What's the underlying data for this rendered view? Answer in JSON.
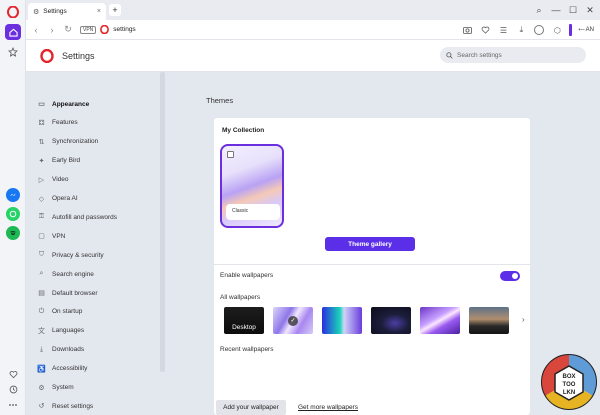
{
  "browser": {
    "tab": {
      "title": "Settings",
      "close": "×"
    },
    "new_tab": "+",
    "address": {
      "vpn": "VPN",
      "url": "settings"
    },
    "aria": "AN",
    "window_controls": {
      "search": "⌕",
      "minimize": "—",
      "maximize": "☐",
      "close": "✕"
    }
  },
  "settings": {
    "title": "Settings",
    "search_placeholder": "Search settings"
  },
  "nav": [
    {
      "label": "Appearance",
      "icon": "appearance-icon",
      "glyph": "▭",
      "active": true
    },
    {
      "label": "Features",
      "icon": "features-icon",
      "glyph": "⚃"
    },
    {
      "label": "Synchronization",
      "icon": "sync-icon",
      "glyph": "⇅"
    },
    {
      "label": "Early Bird",
      "icon": "bird-icon",
      "glyph": "✦"
    },
    {
      "label": "Video",
      "icon": "video-icon",
      "glyph": "▷"
    },
    {
      "label": "Opera AI",
      "icon": "ai-icon",
      "glyph": "◇"
    },
    {
      "label": "Autofill and passwords",
      "icon": "key-icon",
      "glyph": "⚿"
    },
    {
      "label": "VPN",
      "icon": "vpn-icon",
      "glyph": "▢"
    },
    {
      "label": "Privacy & security",
      "icon": "shield-icon",
      "glyph": "⛉"
    },
    {
      "label": "Search engine",
      "icon": "search-icon",
      "glyph": "⌕"
    },
    {
      "label": "Default browser",
      "icon": "browser-icon",
      "glyph": "▤"
    },
    {
      "label": "On startup",
      "icon": "power-icon",
      "glyph": "⏻"
    },
    {
      "label": "Languages",
      "icon": "language-icon",
      "glyph": "文"
    },
    {
      "label": "Downloads",
      "icon": "download-icon",
      "glyph": "⤓"
    },
    {
      "label": "Accessibility",
      "icon": "accessibility-icon",
      "glyph": "♿"
    },
    {
      "label": "System",
      "icon": "system-icon",
      "glyph": "⚙"
    },
    {
      "label": "Reset settings",
      "icon": "reset-icon",
      "glyph": "↺"
    }
  ],
  "main": {
    "section_title": "Themes",
    "collection_title": "My Collection",
    "theme_name": "Classic",
    "gallery_button": "Theme gallery",
    "enable_wallpapers": "Enable wallpapers",
    "enable_wallpapers_on": true,
    "all_wallpapers": "All wallpapers",
    "desktop_wallpaper": "Desktop",
    "selected_check": "✓",
    "next_arrow": "›",
    "recent_wallpapers": "Recent wallpapers",
    "add_wallpaper_button": "Add your wallpaper",
    "more_wallpapers_link": "Get more wallpapers"
  },
  "badge": {
    "text_top": "BOX",
    "text_mid": "TOO",
    "text_bot": "LKN"
  },
  "colors": {
    "accent": "#5b2ee8",
    "opera_red": "#e4262c"
  }
}
